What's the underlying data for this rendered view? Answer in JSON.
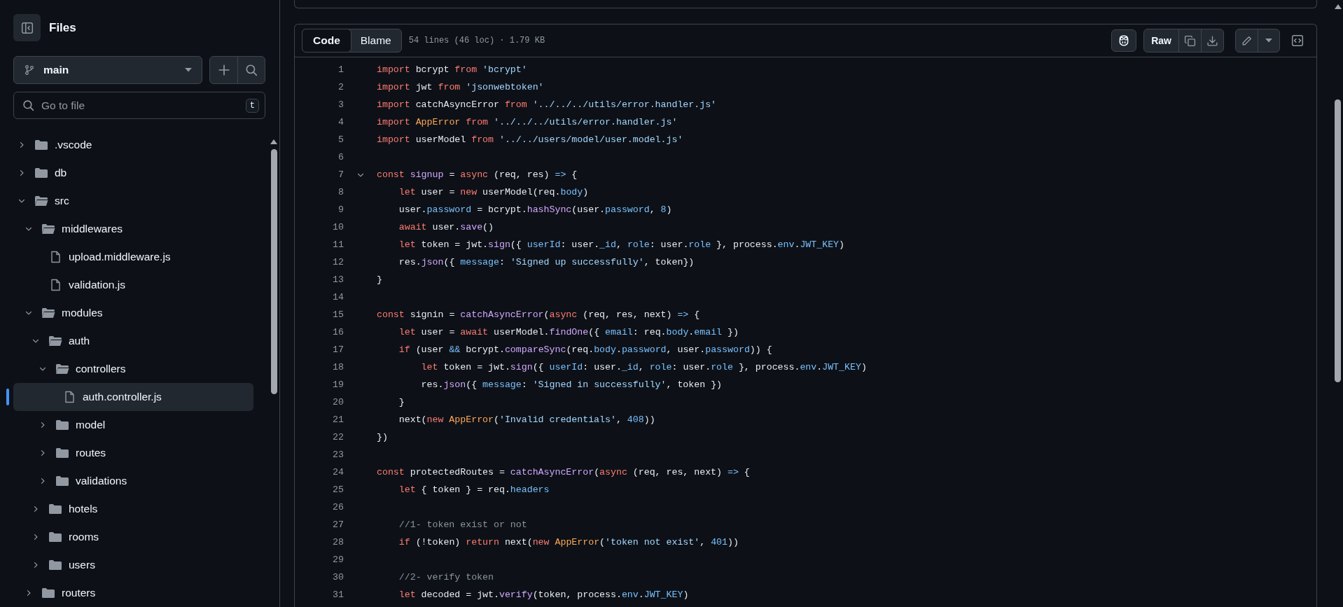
{
  "sidebar": {
    "title": "Files",
    "branch": "main",
    "search": {
      "placeholder": "Go to file",
      "shortcut": "t"
    },
    "tree": [
      {
        "name": ".vscode",
        "kind": "folder",
        "expanded": false,
        "selected": false
      },
      {
        "name": "db",
        "kind": "folder",
        "expanded": false,
        "selected": false
      },
      {
        "name": "src",
        "kind": "folder",
        "expanded": true,
        "selected": false,
        "children": [
          {
            "name": "middlewares",
            "kind": "folder",
            "expanded": true,
            "selected": false,
            "children": [
              {
                "name": "upload.middleware.js",
                "kind": "file",
                "selected": false
              },
              {
                "name": "validation.js",
                "kind": "file",
                "selected": false
              }
            ]
          },
          {
            "name": "modules",
            "kind": "folder",
            "expanded": true,
            "selected": false,
            "children": [
              {
                "name": "auth",
                "kind": "folder",
                "expanded": true,
                "selected": false,
                "children": [
                  {
                    "name": "controllers",
                    "kind": "folder",
                    "expanded": true,
                    "selected": false,
                    "children": [
                      {
                        "name": "auth.controller.js",
                        "kind": "file",
                        "selected": true
                      }
                    ]
                  },
                  {
                    "name": "model",
                    "kind": "folder",
                    "expanded": false,
                    "selected": false
                  },
                  {
                    "name": "routes",
                    "kind": "folder",
                    "expanded": false,
                    "selected": false
                  },
                  {
                    "name": "validations",
                    "kind": "folder",
                    "expanded": false,
                    "selected": false
                  }
                ]
              },
              {
                "name": "hotels",
                "kind": "folder",
                "expanded": false,
                "selected": false
              },
              {
                "name": "rooms",
                "kind": "folder",
                "expanded": false,
                "selected": false
              },
              {
                "name": "users",
                "kind": "folder",
                "expanded": false,
                "selected": false
              }
            ]
          },
          {
            "name": "routers",
            "kind": "folder",
            "expanded": false,
            "selected": false
          }
        ]
      }
    ]
  },
  "file_view": {
    "tabs": [
      {
        "label": "Code",
        "selected": true
      },
      {
        "label": "Blame",
        "selected": false
      }
    ],
    "info": "54 lines (46 loc) · 1.79 KB",
    "raw_button": "Raw",
    "lines": [
      {
        "number": "1",
        "tokens": [
          {
            "kind": "keyword",
            "text": "import"
          },
          {
            "kind": "plain",
            "text": " bcrypt "
          },
          {
            "kind": "keyword",
            "text": "from"
          },
          {
            "kind": "string",
            "text": " 'bcrypt'"
          }
        ]
      },
      {
        "number": "2",
        "tokens": [
          {
            "kind": "keyword",
            "text": "import"
          },
          {
            "kind": "plain",
            "text": " jwt "
          },
          {
            "kind": "keyword",
            "text": "from"
          },
          {
            "kind": "string",
            "text": " 'jsonwebtoken'"
          }
        ]
      },
      {
        "number": "3",
        "tokens": [
          {
            "kind": "keyword",
            "text": "import"
          },
          {
            "kind": "plain",
            "text": " catchAsyncError "
          },
          {
            "kind": "keyword",
            "text": "from"
          },
          {
            "kind": "string",
            "text": " '../../../utils/error.handler.js'"
          }
        ]
      },
      {
        "number": "4",
        "tokens": [
          {
            "kind": "keyword",
            "text": "import"
          },
          {
            "kind": "class",
            "text": " AppError"
          },
          {
            "kind": "keyword",
            "text": " from"
          },
          {
            "kind": "string",
            "text": " '../../../utils/error.handler.js'"
          }
        ]
      },
      {
        "number": "5",
        "tokens": [
          {
            "kind": "keyword",
            "text": "import"
          },
          {
            "kind": "plain",
            "text": " userModel "
          },
          {
            "kind": "keyword",
            "text": "from"
          },
          {
            "kind": "string",
            "text": " '../../users/model/user.model.js'"
          }
        ]
      },
      {
        "number": "6"
      },
      {
        "number": "7",
        "expanded": true,
        "tokens": [
          {
            "kind": "keyword",
            "text": "const"
          },
          {
            "kind": "function",
            "text": " signup"
          },
          {
            "kind": "plain",
            "text": " = "
          },
          {
            "kind": "keyword",
            "text": "async"
          },
          {
            "kind": "plain",
            "text": " (req, res) "
          },
          {
            "kind": "constant",
            "text": "=>"
          },
          {
            "kind": "plain",
            "text": " {"
          }
        ]
      },
      {
        "number": "8",
        "tokens": [
          {
            "kind": "keyword",
            "text": "    let"
          },
          {
            "kind": "plain",
            "text": " user = "
          },
          {
            "kind": "keyword",
            "text": "new"
          },
          {
            "kind": "plain",
            "text": " userModel(req."
          },
          {
            "kind": "constant",
            "text": "body"
          },
          {
            "kind": "plain",
            "text": ")"
          }
        ]
      },
      {
        "number": "9",
        "tokens": [
          {
            "kind": "plain",
            "text": "    user."
          },
          {
            "kind": "constant",
            "text": "password"
          },
          {
            "kind": "plain",
            "text": " = bcrypt."
          },
          {
            "kind": "function",
            "text": "hashSync"
          },
          {
            "kind": "plain",
            "text": "(user."
          },
          {
            "kind": "constant",
            "text": "password"
          },
          {
            "kind": "plain",
            "text": ", "
          },
          {
            "kind": "constant",
            "text": "8"
          },
          {
            "kind": "plain",
            "text": ")"
          }
        ]
      },
      {
        "number": "10",
        "tokens": [
          {
            "kind": "keyword",
            "text": "    await"
          },
          {
            "kind": "plain",
            "text": " user."
          },
          {
            "kind": "function",
            "text": "save"
          },
          {
            "kind": "plain",
            "text": "()"
          }
        ]
      },
      {
        "number": "11",
        "tokens": [
          {
            "kind": "keyword",
            "text": "    let"
          },
          {
            "kind": "plain",
            "text": " token = jwt."
          },
          {
            "kind": "function",
            "text": "sign"
          },
          {
            "kind": "plain",
            "text": "({ "
          },
          {
            "kind": "constant",
            "text": "userId"
          },
          {
            "kind": "plain",
            "text": ": user."
          },
          {
            "kind": "constant",
            "text": "_id"
          },
          {
            "kind": "plain",
            "text": ", "
          },
          {
            "kind": "constant",
            "text": "role"
          },
          {
            "kind": "plain",
            "text": ": user."
          },
          {
            "kind": "constant",
            "text": "role"
          },
          {
            "kind": "plain",
            "text": " }, process."
          },
          {
            "kind": "constant",
            "text": "env"
          },
          {
            "kind": "plain",
            "text": "."
          },
          {
            "kind": "constant",
            "text": "JWT_KEY"
          },
          {
            "kind": "plain",
            "text": ")"
          }
        ]
      },
      {
        "number": "12",
        "tokens": [
          {
            "kind": "plain",
            "text": "    res."
          },
          {
            "kind": "function",
            "text": "json"
          },
          {
            "kind": "plain",
            "text": "({ "
          },
          {
            "kind": "constant",
            "text": "message"
          },
          {
            "kind": "plain",
            "text": ": "
          },
          {
            "kind": "string",
            "text": "'Signed up successfully'"
          },
          {
            "kind": "plain",
            "text": ", token})"
          }
        ]
      },
      {
        "number": "13",
        "tokens": [
          {
            "kind": "plain",
            "text": "}"
          }
        ]
      },
      {
        "number": "14"
      },
      {
        "number": "15",
        "tokens": [
          {
            "kind": "keyword",
            "text": "const"
          },
          {
            "kind": "plain",
            "text": " signin = "
          },
          {
            "kind": "function",
            "text": "catchAsyncError"
          },
          {
            "kind": "plain",
            "text": "("
          },
          {
            "kind": "keyword",
            "text": "async"
          },
          {
            "kind": "plain",
            "text": " (req, res, next) "
          },
          {
            "kind": "constant",
            "text": "=>"
          },
          {
            "kind": "plain",
            "text": " {"
          }
        ]
      },
      {
        "number": "16",
        "tokens": [
          {
            "kind": "keyword",
            "text": "    let"
          },
          {
            "kind": "plain",
            "text": " user = "
          },
          {
            "kind": "keyword",
            "text": "await"
          },
          {
            "kind": "plain",
            "text": " userModel."
          },
          {
            "kind": "function",
            "text": "findOne"
          },
          {
            "kind": "plain",
            "text": "({ "
          },
          {
            "kind": "constant",
            "text": "email"
          },
          {
            "kind": "plain",
            "text": ": req."
          },
          {
            "kind": "constant",
            "text": "body"
          },
          {
            "kind": "plain",
            "text": "."
          },
          {
            "kind": "constant",
            "text": "email"
          },
          {
            "kind": "plain",
            "text": " })"
          }
        ]
      },
      {
        "number": "17",
        "tokens": [
          {
            "kind": "keyword",
            "text": "    if"
          },
          {
            "kind": "plain",
            "text": " (user "
          },
          {
            "kind": "constant",
            "text": "&&"
          },
          {
            "kind": "plain",
            "text": " bcrypt."
          },
          {
            "kind": "function",
            "text": "compareSync"
          },
          {
            "kind": "plain",
            "text": "(req."
          },
          {
            "kind": "constant",
            "text": "body"
          },
          {
            "kind": "plain",
            "text": "."
          },
          {
            "kind": "constant",
            "text": "password"
          },
          {
            "kind": "plain",
            "text": ", user."
          },
          {
            "kind": "constant",
            "text": "password"
          },
          {
            "kind": "plain",
            "text": ")) {"
          }
        ]
      },
      {
        "number": "18",
        "tokens": [
          {
            "kind": "keyword",
            "text": "        let"
          },
          {
            "kind": "plain",
            "text": " token = jwt."
          },
          {
            "kind": "function",
            "text": "sign"
          },
          {
            "kind": "plain",
            "text": "({ "
          },
          {
            "kind": "constant",
            "text": "userId"
          },
          {
            "kind": "plain",
            "text": ": user."
          },
          {
            "kind": "constant",
            "text": "_id"
          },
          {
            "kind": "plain",
            "text": ", "
          },
          {
            "kind": "constant",
            "text": "role"
          },
          {
            "kind": "plain",
            "text": ": user."
          },
          {
            "kind": "constant",
            "text": "role"
          },
          {
            "kind": "plain",
            "text": " }, process."
          },
          {
            "kind": "constant",
            "text": "env"
          },
          {
            "kind": "plain",
            "text": "."
          },
          {
            "kind": "constant",
            "text": "JWT_KEY"
          },
          {
            "kind": "plain",
            "text": ")"
          }
        ]
      },
      {
        "number": "19",
        "tokens": [
          {
            "kind": "plain",
            "text": "        res."
          },
          {
            "kind": "function",
            "text": "json"
          },
          {
            "kind": "plain",
            "text": "({ "
          },
          {
            "kind": "constant",
            "text": "message"
          },
          {
            "kind": "plain",
            "text": ": "
          },
          {
            "kind": "string",
            "text": "'Signed in successfully'"
          },
          {
            "kind": "plain",
            "text": ", token })"
          }
        ]
      },
      {
        "number": "20",
        "tokens": [
          {
            "kind": "plain",
            "text": "    }"
          }
        ]
      },
      {
        "number": "21",
        "tokens": [
          {
            "kind": "plain",
            "text": "    next("
          },
          {
            "kind": "keyword",
            "text": "new"
          },
          {
            "kind": "class",
            "text": " AppError"
          },
          {
            "kind": "plain",
            "text": "("
          },
          {
            "kind": "string",
            "text": "'Invalid credentials'"
          },
          {
            "kind": "plain",
            "text": ", "
          },
          {
            "kind": "constant",
            "text": "408"
          },
          {
            "kind": "plain",
            "text": "))"
          }
        ]
      },
      {
        "number": "22",
        "tokens": [
          {
            "kind": "plain",
            "text": "})"
          }
        ]
      },
      {
        "number": "23"
      },
      {
        "number": "24",
        "tokens": [
          {
            "kind": "keyword",
            "text": "const"
          },
          {
            "kind": "plain",
            "text": " protectedRoutes = "
          },
          {
            "kind": "function",
            "text": "catchAsyncError"
          },
          {
            "kind": "plain",
            "text": "("
          },
          {
            "kind": "keyword",
            "text": "async"
          },
          {
            "kind": "plain",
            "text": " (req, res, next) "
          },
          {
            "kind": "constant",
            "text": "=>"
          },
          {
            "kind": "plain",
            "text": " {"
          }
        ]
      },
      {
        "number": "25",
        "tokens": [
          {
            "kind": "keyword",
            "text": "    let"
          },
          {
            "kind": "plain",
            "text": " { token } = req."
          },
          {
            "kind": "constant",
            "text": "headers"
          }
        ]
      },
      {
        "number": "26"
      },
      {
        "number": "27",
        "tokens": [
          {
            "kind": "comment",
            "text": "    //1- token exist or not"
          }
        ]
      },
      {
        "number": "28",
        "tokens": [
          {
            "kind": "keyword",
            "text": "    if"
          },
          {
            "kind": "plain",
            "text": " (!token) "
          },
          {
            "kind": "keyword",
            "text": "return"
          },
          {
            "kind": "plain",
            "text": " next("
          },
          {
            "kind": "keyword",
            "text": "new"
          },
          {
            "kind": "class",
            "text": " AppError"
          },
          {
            "kind": "plain",
            "text": "("
          },
          {
            "kind": "string",
            "text": "'token not exist'"
          },
          {
            "kind": "plain",
            "text": ", "
          },
          {
            "kind": "constant",
            "text": "401"
          },
          {
            "kind": "plain",
            "text": "))"
          }
        ]
      },
      {
        "number": "29"
      },
      {
        "number": "30",
        "tokens": [
          {
            "kind": "comment",
            "text": "    //2- verify token"
          }
        ]
      },
      {
        "number": "31",
        "tokens": [
          {
            "kind": "keyword",
            "text": "    let"
          },
          {
            "kind": "plain",
            "text": " decoded = jwt."
          },
          {
            "kind": "function",
            "text": "verify"
          },
          {
            "kind": "plain",
            "text": "(token, process."
          },
          {
            "kind": "constant",
            "text": "env"
          },
          {
            "kind": "plain",
            "text": "."
          },
          {
            "kind": "constant",
            "text": "JWT_KEY"
          },
          {
            "kind": "plain",
            "text": ")"
          }
        ]
      }
    ]
  }
}
